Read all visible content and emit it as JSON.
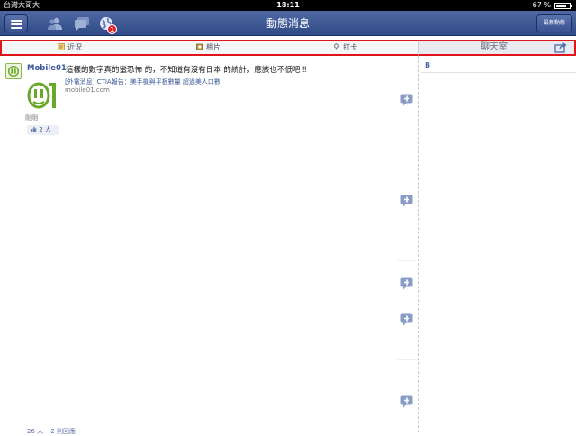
{
  "status_bar": {
    "carrier": "台灣大哥大",
    "time": "18:11",
    "battery": "67 %"
  },
  "nav": {
    "title": "動態消息",
    "latest_label": "最新動態",
    "notification_count": "1"
  },
  "actions": {
    "status": "近況",
    "photo": "相片",
    "checkin": "打卡"
  },
  "chat": {
    "title": "聊天室",
    "section_letter": "B"
  },
  "post": {
    "author": "Mobile01",
    "text": "這樣的數字真的蠻恐怖  的，不知道有沒有日本  的統計，應該也不低吧 ‼",
    "link_title": "[外電消息] CTIA報告：美手機與平板數量 超過美人口數",
    "link_domain": "mobile01.com",
    "time": "剛剛",
    "likes": "2 人"
  },
  "post2": {
    "likes": "26 人",
    "comments": "2 則回應"
  },
  "colors": {
    "nav_blue": "#3b5998",
    "highlight_red": "#e0151a",
    "mobile01_green": "#8ab84a"
  },
  "icons": [
    "menu-icon",
    "friends-icon",
    "messages-icon",
    "notifications-icon",
    "status-icon",
    "photo-icon",
    "checkin-icon",
    "share-icon",
    "comment-icon",
    "like-icon"
  ]
}
